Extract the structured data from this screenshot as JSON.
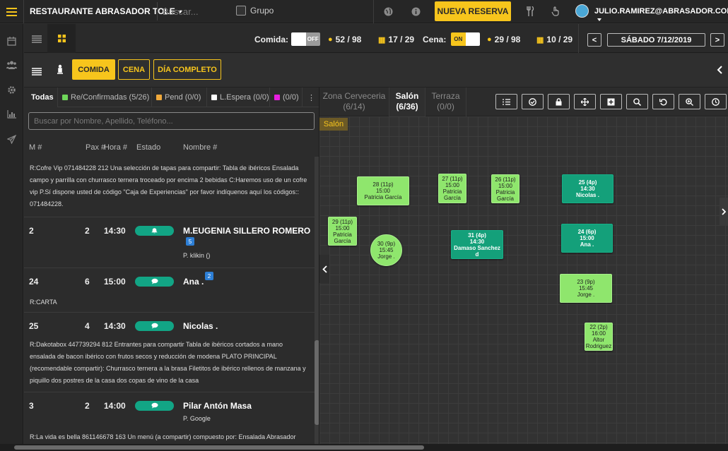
{
  "topbar": {
    "restaurant": "RESTAURANTE ABRASADOR TOLE",
    "search_placeholder": "Buscar...",
    "grupo_label": "Grupo",
    "nueva_reserva": "NUEVA RESERVA",
    "user": "JULIO.RAMIREZ@ABRASADOR.COM"
  },
  "bar2": {
    "comida_label": "Comida:",
    "comida_toggle": "OFF",
    "comida_people": "52 / 98",
    "comida_tables": "17 / 29",
    "cena_label": "Cena:",
    "cena_toggle": "ON",
    "cena_people": "29 / 98",
    "cena_tables": "10 / 29",
    "date": "SÁBADO 7/12/2019",
    "prev": "<",
    "next": ">"
  },
  "service_buttons": [
    "COMIDA",
    "CENA",
    "DÍA COMPLETO"
  ],
  "filter_tabs": [
    {
      "label": "Todas",
      "color": ""
    },
    {
      "label": "Re/Confirmadas (5/26)",
      "color": "#6fd65a"
    },
    {
      "label": "Pend (0/0)",
      "color": "#f0a93b"
    },
    {
      "label": "L.Espera (0/0)",
      "color": "#ffffff"
    },
    {
      "label": "(0/0)",
      "color": "#e81ee0"
    }
  ],
  "list_search_placeholder": "Buscar por Nombre, Apellido, Teléfono...",
  "columns": {
    "mesa": "M #",
    "pax": "Pax #",
    "hora": "Hora #",
    "estado": "Estado",
    "nombre": "Nombre #"
  },
  "top_note": "R:Cofre Vip 071484228 212 Una selección de tapas para compartir: Tabla de ibéricos Ensalada campo y parrilla con churrasco ternera troceado por encima 2 bebidas C:Haremos uso de un cofre vip P.Sí dispone usted de código \"Caja de Experiencias\" por favor indíquenos aquí los códigos:: 071484228.",
  "reservations": [
    {
      "mesa": "2",
      "pax": "2",
      "hora": "14:30",
      "estado_icon": "bell-icon",
      "nombre": "M.EUGENIA SILLERO ROMERO",
      "count": "5",
      "source": "P. klikin ()",
      "note": ""
    },
    {
      "mesa": "24",
      "pax": "6",
      "hora": "15:00",
      "estado_icon": "chat-icon",
      "nombre": "Ana .",
      "count": "2",
      "source": "",
      "note": "R:CARTA"
    },
    {
      "mesa": "25",
      "pax": "4",
      "hora": "14:30",
      "estado_icon": "chat-icon",
      "nombre": "Nicolas .",
      "count": "",
      "source": "",
      "note": "R:Dakotabox 447739294 812 Entrantes para compartir Tabla de ibéricos cortados a mano ensalada de bacon ibérico con frutos secos y reducción de modena PLATO PRINCIPAL (recomendable compartir): Churrasco ternera a la brasa Filetitos de ibérico rellenos de manzana y piquillo dos postres de la casa dos copas de vino de la casa"
    },
    {
      "mesa": "3",
      "pax": "2",
      "hora": "14:00",
      "estado_icon": "chat-icon",
      "nombre": "Pilar Antón Masa",
      "count": "",
      "source": "P. Google",
      "note": "R:La vida es bella 861146678 163 Un menú (a compartir) compuesto por: Ensalada Abrasador"
    }
  ],
  "zones": [
    {
      "name": "Zona Cerveceria",
      "count": "(6/14)"
    },
    {
      "name": "Salón",
      "count": "(6/36)"
    },
    {
      "name": "Terraza",
      "count": "(0/0)"
    }
  ],
  "area_label": "Salón",
  "tables": [
    {
      "l1": "28 (11p)",
      "l2": "15:00",
      "l3": "Patricia García",
      "l4": "",
      "style": "light"
    },
    {
      "l1": "27 (11p)",
      "l2": "15:00",
      "l3": "Patricia",
      "l4": "García",
      "style": "light"
    },
    {
      "l1": "26 (11p)",
      "l2": "15:00",
      "l3": "Patricia",
      "l4": "García",
      "style": "light"
    },
    {
      "l1": "25 (4p)",
      "l2": "14:30",
      "l3": "Nicolas .",
      "l4": "",
      "style": "dark"
    },
    {
      "l1": "29 (11p)",
      "l2": "15:00",
      "l3": "Patricia",
      "l4": "García",
      "style": "light"
    },
    {
      "l1": "30 (9p)",
      "l2": "15:45",
      "l3": "Jorge .",
      "l4": "",
      "style": "light"
    },
    {
      "l1": "31 (4p)",
      "l2": "14:30",
      "l3": "Damaso Sanchez d",
      "l4": "",
      "style": "dark"
    },
    {
      "l1": "24 (6p)",
      "l2": "15:00",
      "l3": "Ana .",
      "l4": "",
      "style": "dark"
    },
    {
      "l1": "23 (9p)",
      "l2": "15:45",
      "l3": "Jorge .",
      "l4": "",
      "style": "light"
    },
    {
      "l1": "22 (2p)",
      "l2": "16:00",
      "l3": "Altor",
      "l4": "Rodriguez",
      "style": "light"
    }
  ]
}
